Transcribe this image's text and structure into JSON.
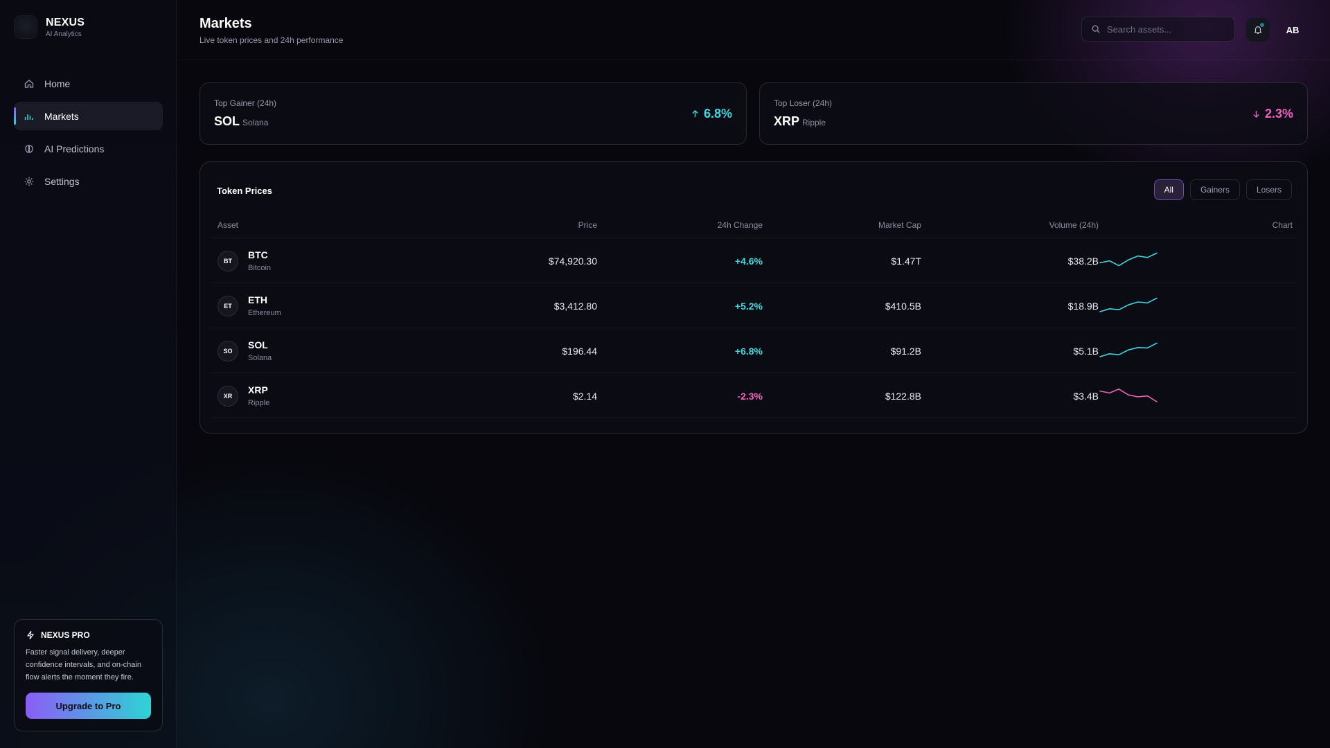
{
  "brand": {
    "name": "NEXUS",
    "sub": "AI Analytics"
  },
  "nav": [
    {
      "label": "Home",
      "icon": "home-icon"
    },
    {
      "label": "Markets",
      "icon": "bar-chart-icon"
    },
    {
      "label": "AI Predictions",
      "icon": "brain-icon"
    },
    {
      "label": "Settings",
      "icon": "gear-icon"
    }
  ],
  "promo": {
    "title": "NEXUS PRO",
    "desc": "Faster signal delivery, deeper confidence intervals, and on-chain flow alerts the moment they fire.",
    "button": "Upgrade to Pro"
  },
  "header": {
    "title": "Markets",
    "subtitle": "Live token prices and 24h performance",
    "search_placeholder": "Search assets...",
    "avatar": "AB"
  },
  "top_gainer": {
    "label": "Top Gainer (24h)",
    "symbol": "SOL",
    "name": "Solana",
    "change": "6.8%"
  },
  "top_loser": {
    "label": "Top Loser (24h)",
    "symbol": "XRP",
    "name": "Ripple",
    "change": "2.3%"
  },
  "table": {
    "title": "Token Prices",
    "filters": [
      "All",
      "Gainers",
      "Losers"
    ],
    "columns": [
      "Asset",
      "Price",
      "24h Change",
      "Market Cap",
      "Volume (24h)",
      "Chart"
    ],
    "rows": [
      {
        "icon": "BT",
        "symbol": "BTC",
        "name": "Bitcoin",
        "price": "$74,920.30",
        "change": "+4.6%",
        "cap": "$1.47T",
        "volume": "$38.2B"
      },
      {
        "icon": "ET",
        "symbol": "ETH",
        "name": "Ethereum",
        "price": "$3,412.80",
        "change": "+5.2%",
        "cap": "$410.5B",
        "volume": "$18.9B"
      },
      {
        "icon": "SO",
        "symbol": "SOL",
        "name": "Solana",
        "price": "$196.44",
        "change": "+6.8%",
        "cap": "$91.2B",
        "volume": "$5.1B"
      },
      {
        "icon": "XR",
        "symbol": "XRP",
        "name": "Ripple",
        "price": "$2.14",
        "change": "-2.3%",
        "cap": "$122.8B",
        "volume": "$3.4B"
      }
    ]
  },
  "sparklines": [
    [
      0.45,
      0.55,
      0.3,
      0.6,
      0.8,
      0.72,
      0.95
    ],
    [
      0.25,
      0.4,
      0.35,
      0.6,
      0.75,
      0.7,
      0.95
    ],
    [
      0.25,
      0.4,
      0.35,
      0.6,
      0.72,
      0.7,
      0.95
    ],
    [
      0.8,
      0.7,
      0.9,
      0.6,
      0.5,
      0.55,
      0.25
    ]
  ],
  "colors": {
    "accent_purple": "#8b5cf6",
    "positive": "#40d8e0",
    "negative": "#f062c0"
  }
}
